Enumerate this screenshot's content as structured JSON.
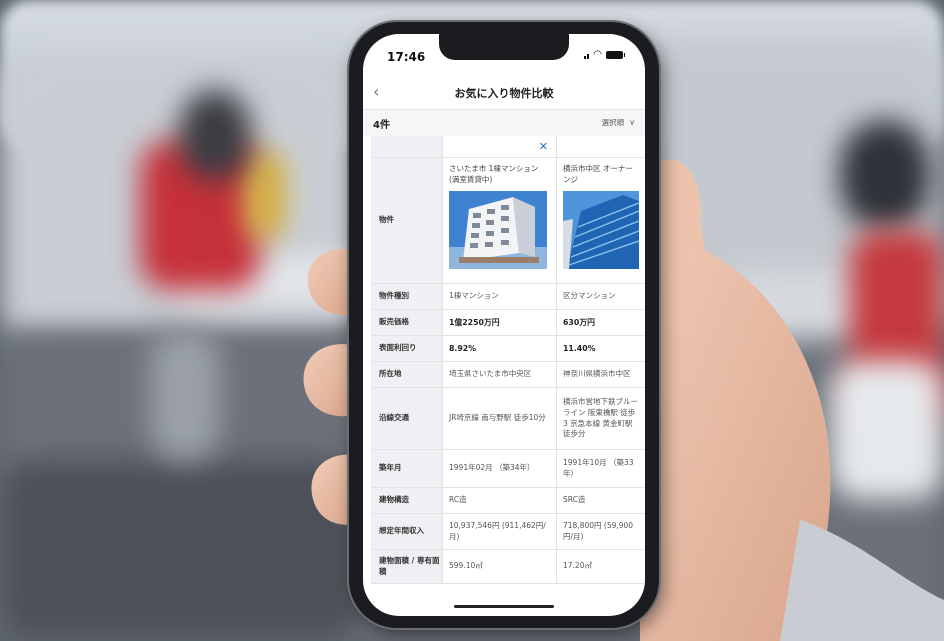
{
  "status_bar": {
    "time": "17:46"
  },
  "nav": {
    "title": "お気に入り物件比較"
  },
  "summary": {
    "count": "4件",
    "sort_label": "選択順"
  },
  "table": {
    "property_header": "物件",
    "properties": [
      {
        "name": "さいたま市 1棟マンション (満室賃貸中)"
      },
      {
        "name": "横浜市中区 オーナーンジ"
      }
    ],
    "rows": [
      {
        "label": "物件種別",
        "values": [
          "1棟マンション",
          "区分マンション"
        ],
        "bold": false
      },
      {
        "label": "販売価格",
        "values": [
          "1億2250万円",
          "630万円"
        ],
        "bold": true
      },
      {
        "label": "表面利回り",
        "values": [
          "8.92%",
          "11.40%"
        ],
        "bold": true
      },
      {
        "label": "所在地",
        "values": [
          "埼玉県さいたま市中央区",
          "神奈川県横浜市中区"
        ],
        "bold": false
      },
      {
        "label": "沿線交通",
        "values": [
          "JR埼京線 南与野駅 徒歩10分",
          "横浜市営地下鉄ブルーライン 阪東橋駅 徒歩3 京急本線 黄金町駅 徒歩分"
        ],
        "bold": false
      },
      {
        "label": "築年月",
        "values": [
          "1991年02月 （築34年）",
          "1991年10月 （築33年）"
        ],
        "bold": false
      },
      {
        "label": "建物構造",
        "values": [
          "RC造",
          "SRC造"
        ],
        "bold": false
      },
      {
        "label": "想定年間収入",
        "values": [
          "10,937,546円 (911,462円/月)",
          "718,800円 (59,900円/月)"
        ],
        "bold": false
      },
      {
        "label": "建物面積 / 専有面積",
        "values": [
          "599.10㎡",
          "17.20㎡"
        ],
        "bold": false
      }
    ]
  },
  "colors": {
    "accent": "#2c6fc9",
    "header_bg": "#eef0f3"
  }
}
